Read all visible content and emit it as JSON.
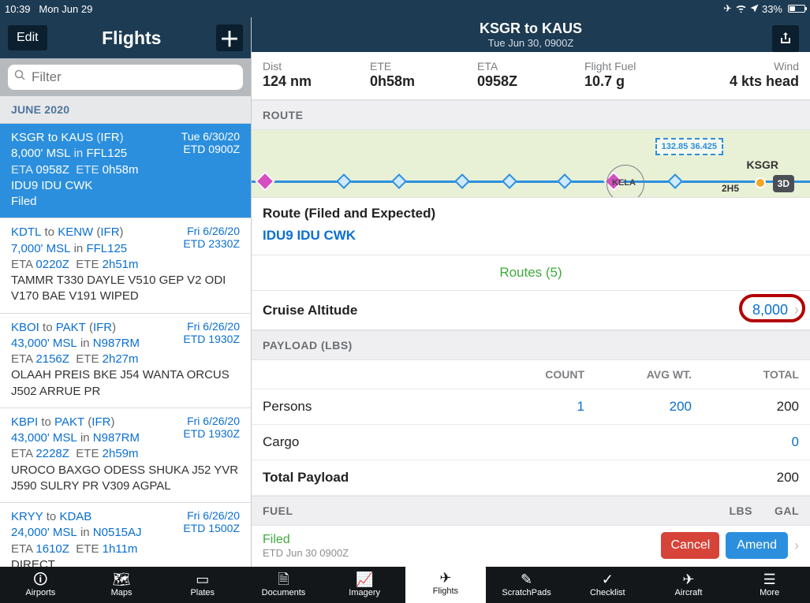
{
  "statusbar": {
    "time": "10:39",
    "date": "Mon Jun 29",
    "battery": "33%"
  },
  "sidebar": {
    "edit": "Edit",
    "title": "Flights",
    "filter_placeholder": "Filter",
    "month": "JUNE 2020",
    "items": [
      {
        "origin": "KSGR",
        "dest": "KAUS",
        "rules": "(IFR)",
        "alt": "8,000' MSL",
        "in": "in",
        "plan": "FFL125",
        "eta_lbl": "ETA",
        "eta": "0958Z",
        "ete_lbl": "ETE",
        "ete": "0h58m",
        "route": "IDU9 IDU CWK",
        "status": "Filed",
        "date": "Tue 6/30/20",
        "etd": "ETD 0900Z",
        "selected": true
      },
      {
        "origin": "KDTL",
        "dest": "KENW",
        "rules": "(IFR)",
        "alt": "7,000' MSL",
        "in": "in",
        "plan": "FFL125",
        "eta_lbl": "ETA",
        "eta": "0220Z",
        "ete_lbl": "ETE",
        "ete": "2h51m",
        "route": "TAMMR T330 DAYLE V510 GEP V2 ODI V170 BAE V191 WIPED",
        "date": "Fri 6/26/20",
        "etd": "ETD 2330Z"
      },
      {
        "origin": "KBOI",
        "dest": "PAKT",
        "rules": "(IFR)",
        "alt": "43,000' MSL",
        "in": "in",
        "plan": "N987RM",
        "eta_lbl": "ETA",
        "eta": "2156Z",
        "ete_lbl": "ETE",
        "ete": "2h27m",
        "route": "OLAAH PREIS BKE J54 WANTA ORCUS J502 ARRUE PR",
        "date": "Fri 6/26/20",
        "etd": "ETD 1930Z"
      },
      {
        "origin": "KBPI",
        "dest": "PAKT",
        "rules": "(IFR)",
        "alt": "43,000' MSL",
        "in": "in",
        "plan": "N987RM",
        "eta_lbl": "ETA",
        "eta": "2228Z",
        "ete_lbl": "ETE",
        "ete": "2h59m",
        "route": "UROCO BAXGO ODESS SHUKA J52 YVR J590 SULRY PR V309 AGPAL",
        "date": "Fri 6/26/20",
        "etd": "ETD 1930Z"
      },
      {
        "origin": "KRYY",
        "dest": "KDAB",
        "rules": "",
        "alt": "24,000' MSL",
        "in": "in",
        "plan": "N0515AJ",
        "eta_lbl": "ETA",
        "eta": "1610Z",
        "ete_lbl": "ETE",
        "ete": "1h11m",
        "route": "DIRECT",
        "date": "Fri 6/26/20",
        "etd": "ETD 1500Z"
      }
    ]
  },
  "header": {
    "title": "KSGR to KAUS",
    "subtitle": "Tue Jun 30, 0900Z"
  },
  "stats": {
    "dist_lbl": "Dist",
    "dist": "124 nm",
    "ete_lbl": "ETE",
    "ete": "0h58m",
    "eta_lbl": "ETA",
    "eta": "0958Z",
    "fuel_lbl": "Flight Fuel",
    "fuel": "10.7 g",
    "wind_lbl": "Wind",
    "wind": "4 kts head"
  },
  "sections": {
    "route": "ROUTE",
    "payload": "PAYLOAD (LBS)",
    "fuel": "FUEL",
    "lbs": "LBS",
    "gal": "GAL"
  },
  "map": {
    "box": "132.85 36.425",
    "kela": "KELA",
    "ksgr": "KSGR",
    "h2": "2H5",
    "btn3d": "3D"
  },
  "route": {
    "title": "Route (Filed and Expected)",
    "value": "IDU9 IDU CWK",
    "routes_btn": "Routes (5)"
  },
  "cruise": {
    "label": "Cruise Altitude",
    "value": "8,000"
  },
  "payload": {
    "head_count": "COUNT",
    "head_avg": "AVG WT.",
    "head_total": "TOTAL",
    "persons_lbl": "Persons",
    "persons_count": "1",
    "persons_avg": "200",
    "persons_total": "200",
    "cargo_lbl": "Cargo",
    "cargo_total": "0",
    "total_lbl": "Total Payload",
    "total_val": "200"
  },
  "filed": {
    "label": "Filed",
    "sub": "ETD Jun 30 0900Z",
    "cancel": "Cancel",
    "amend": "Amend"
  },
  "tabs": {
    "airports": "Airports",
    "maps": "Maps",
    "plates": "Plates",
    "documents": "Documents",
    "imagery": "Imagery",
    "flights": "Flights",
    "scratchpads": "ScratchPads",
    "checklist": "Checklist",
    "aircraft": "Aircraft",
    "more": "More"
  }
}
